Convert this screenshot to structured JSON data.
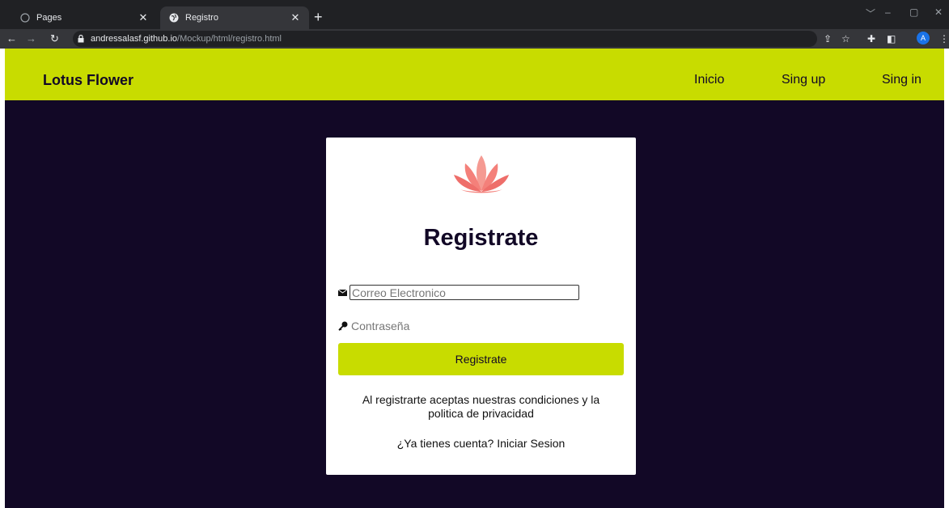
{
  "browser": {
    "tabs": [
      {
        "title": "Pages",
        "active": false
      },
      {
        "title": "Registro",
        "active": true
      }
    ],
    "url_host": "andressalasf.github.io",
    "url_path": "/Mockup/html/registro.html",
    "profile_initial": "A"
  },
  "navbar": {
    "brand": "Lotus Flower",
    "links": [
      "Inicio",
      "Sing up",
      "Sing in"
    ]
  },
  "form": {
    "title": "Registrate",
    "email_placeholder": "Correo Electronico",
    "password_placeholder": "Contraseña",
    "submit_label": "Registrate",
    "terms_line1": "Al registrarte aceptas nuestras condiciones y la",
    "terms_line2": "politica de privacidad",
    "login_prompt": "¿Ya tienes cuenta?",
    "login_link": "Iniciar Sesion"
  },
  "colors": {
    "accent": "#c8dc00",
    "page_bg": "#120826",
    "lotus_petal": "#f4807a"
  }
}
